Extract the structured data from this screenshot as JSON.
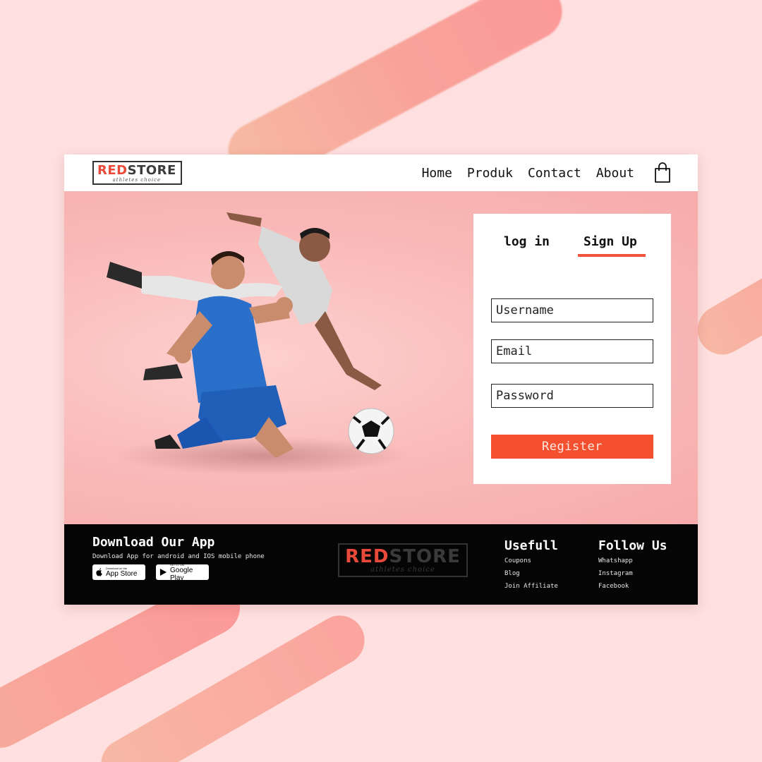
{
  "header": {
    "logo": {
      "red": "RED",
      "dark": "STORE",
      "tagline": "athletes choice"
    },
    "nav": [
      "Home",
      "Produk",
      "Contact",
      "About"
    ]
  },
  "auth": {
    "tabs": {
      "login": "log in",
      "signup": "Sign Up"
    },
    "fields": {
      "username": "Username",
      "email": "Email",
      "password": "Password"
    },
    "register_label": "Register"
  },
  "footer": {
    "download": {
      "title": "Download Our App",
      "subtitle": "Download App for android and IOS mobile phone",
      "app_store": {
        "small": "Download on the",
        "big": "App Store"
      },
      "google_play": {
        "small": "GET IT ON",
        "big": "Google Play"
      }
    },
    "logo": {
      "red": "RED",
      "dark": "STORE",
      "tagline": "athletes choice"
    },
    "useful": {
      "title": "Usefull",
      "links": [
        "Coupons",
        "Blog",
        "Join Affiliate"
      ]
    },
    "follow": {
      "title": "Follow Us",
      "links": [
        "Whatshapp",
        "Instagram",
        "Facebook"
      ]
    }
  },
  "colors": {
    "accent": "#f4502f",
    "brand_red": "#ec4a38",
    "hero_bg": "#f9b8b7",
    "page_bg": "#fde0df"
  }
}
